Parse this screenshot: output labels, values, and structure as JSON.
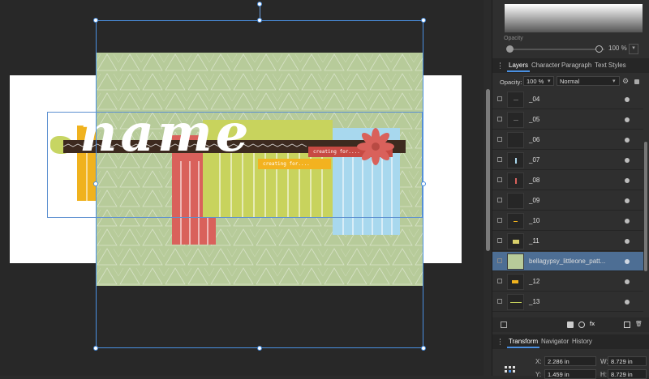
{
  "canvas": {
    "title_word": "name",
    "tag_red_text": "creating for....",
    "tag_yellow_text": "creating for...."
  },
  "colors": {
    "selection": "#4a90e2",
    "paper": "#b3c897",
    "red_fringe": "#d9615b",
    "green_fringe": "#c8d35d",
    "blue_fringe": "#a8d8ee",
    "yellow": "#f0b21e",
    "brown": "#3d2a1f",
    "layer_selected": "#4d6e94"
  },
  "color_panel": {
    "opacity_label": "Opacity",
    "opacity_value": "100 %"
  },
  "tabs": [
    {
      "label": "Layers",
      "active": true
    },
    {
      "label": "Character",
      "active": false
    },
    {
      "label": "Paragraph",
      "active": false
    },
    {
      "label": "Text Styles",
      "active": false
    }
  ],
  "layer_options": {
    "opacity_label": "Opacity:",
    "opacity_value": "100 %",
    "blend_mode": "Normal"
  },
  "layers": [
    {
      "name": "_04",
      "selected": false,
      "thumb": "dash"
    },
    {
      "name": "_05",
      "selected": false,
      "thumb": "dash"
    },
    {
      "name": "_06",
      "selected": false,
      "thumb": "none"
    },
    {
      "name": "_07",
      "selected": false,
      "thumb": "blue"
    },
    {
      "name": "_08",
      "selected": false,
      "thumb": "red"
    },
    {
      "name": "_09",
      "selected": false,
      "thumb": "none"
    },
    {
      "name": "_10",
      "selected": false,
      "thumb": "yellow-dash"
    },
    {
      "name": "_11",
      "selected": false,
      "thumb": "yellow"
    },
    {
      "name": "bellagypsy_littleone_patt...",
      "selected": true,
      "thumb": "paper"
    },
    {
      "name": "_12",
      "selected": false,
      "thumb": "orange"
    },
    {
      "name": "_13",
      "selected": false,
      "thumb": "green-line"
    }
  ],
  "bottom_tabs": [
    {
      "label": "Transform",
      "active": true
    },
    {
      "label": "Navigator",
      "active": false
    },
    {
      "label": "History",
      "active": false
    }
  ],
  "transform": {
    "x_label": "X:",
    "x_value": "2.286 in",
    "w_label": "W:",
    "w_value": "8.729 in",
    "y_label": "Y:",
    "y_value": "1.459 in",
    "h_label": "H:",
    "h_value": "8.729 in"
  }
}
